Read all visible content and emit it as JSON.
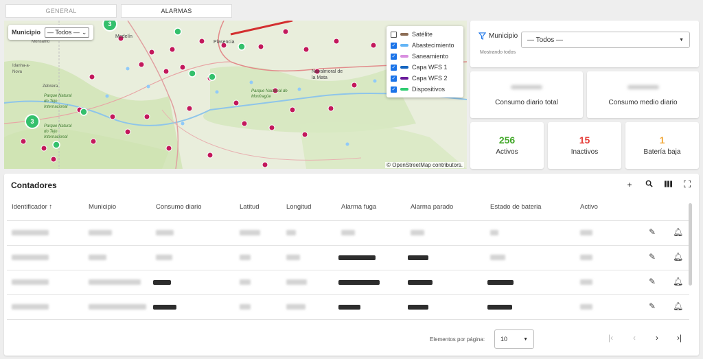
{
  "tabs": [
    {
      "label": "GENERAL"
    },
    {
      "label": "ALARMAS"
    }
  ],
  "map": {
    "municipio_label": "Municipio",
    "municipio_value": "— Todos —",
    "attribution": "© OpenStreetMap contributors.",
    "place_labels": [
      "Monsanto",
      "Idanha-a-Nova",
      "Zebreira",
      "Parque Natural do Tejo Internacional",
      "Medelín",
      "Plasencia",
      "Navalmoral de la Mata",
      "Parque Nacional de Monfragüe",
      "Parque Natural do Tejo Internacional"
    ],
    "cluster_labels": [
      "3",
      "3"
    ],
    "legend": [
      {
        "label": "Satélite",
        "checked": false,
        "color": "#8d6e56"
      },
      {
        "label": "Abastecimiento",
        "checked": true,
        "color": "#64b5f6"
      },
      {
        "label": "Saneamiento",
        "checked": true,
        "color": "#d98fe0"
      },
      {
        "label": "Capa WFS 1",
        "checked": true,
        "color": "#1565c0"
      },
      {
        "label": "Capa WFS 2",
        "checked": true,
        "color": "#6a1b9a"
      },
      {
        "label": "Dispositivos",
        "checked": true,
        "color": "#2ecc71"
      }
    ]
  },
  "filter": {
    "label": "Municipio",
    "value": "— Todos —",
    "note": "Mostrando todos"
  },
  "kpis": [
    {
      "label": "Consumo diario total"
    },
    {
      "label": "Consumo medio diario"
    }
  ],
  "stats": [
    {
      "value": "256",
      "label": "Activos",
      "color": "#43a82b"
    },
    {
      "value": "15",
      "label": "Inactivos",
      "color": "#e53935"
    },
    {
      "value": "1",
      "label": "Batería baja",
      "color": "#f2a93b"
    }
  ],
  "table": {
    "title": "Contadores",
    "columns": [
      "Identificador",
      "Municipio",
      "Consumo diario",
      "Latitud",
      "Longitud",
      "Alarma fuga",
      "Alarma parado",
      "Estado de bateria",
      "Activo"
    ],
    "rows": [
      {
        "cells": [
          "b",
          "b",
          "b",
          "b",
          "b",
          "b",
          "b",
          "b",
          "b"
        ]
      },
      {
        "cells": [
          "b",
          "b",
          "b",
          "b",
          "b",
          "r",
          "r",
          "b",
          "b"
        ]
      },
      {
        "cells": [
          "b",
          "b",
          "r",
          "b",
          "b",
          "r",
          "r",
          "r",
          "b"
        ]
      },
      {
        "cells": [
          "b",
          "b",
          "r",
          "b",
          "b",
          "r",
          "r",
          "r",
          "b"
        ]
      }
    ]
  },
  "pagination": {
    "label": "Elementos por página:",
    "page_size": "10"
  }
}
